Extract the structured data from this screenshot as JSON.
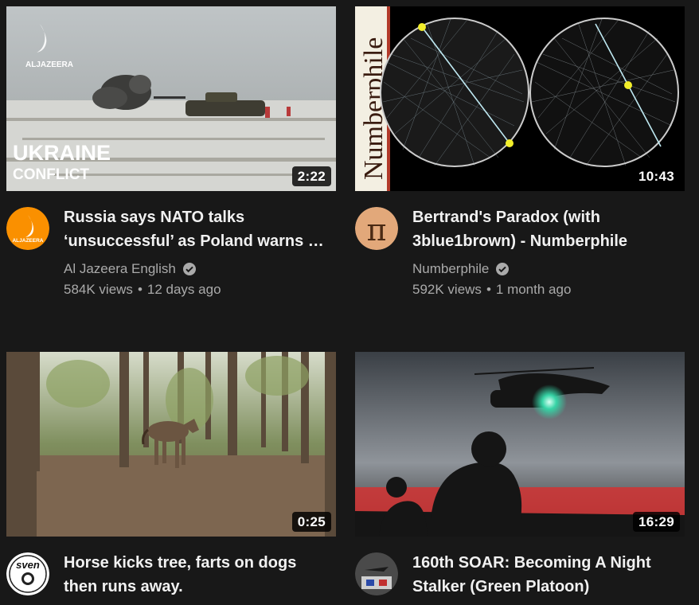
{
  "videos": [
    {
      "title": "Russia says NATO talks ‘unsuccessful’ as Poland warns of war risk",
      "channel": "Al Jazeera English",
      "views": "584K views",
      "age": "12 days ago",
      "duration": "2:22",
      "thumb_text": {
        "logo": "ALJAZEERA",
        "line1": "UKRAINE",
        "line2": "CONFLICT"
      },
      "avatar_text": "ALJAZEERA",
      "verified": true
    },
    {
      "title": "Bertrand's Paradox (with 3blue1brown) - Numberphile",
      "channel": "Numberphile",
      "views": "592K views",
      "age": "1 month ago",
      "duration": "10:43",
      "thumb_text": {
        "logo": "Numberphile"
      },
      "avatar_text": "π",
      "verified": true
    },
    {
      "title": "Horse kicks tree, farts on dogs then runs away.",
      "channel": "",
      "views": "",
      "age": "",
      "duration": "0:25",
      "avatar_text": "sven"
    },
    {
      "title": "160th SOAR: Becoming A Night Stalker (Green Platoon)",
      "channel": "",
      "views": "",
      "age": "",
      "duration": "16:29"
    }
  ],
  "colors": {
    "background": "#181818",
    "title": "#f1f1f1",
    "secondary": "#aaaaaa",
    "aljazeera": "#fa9000"
  }
}
